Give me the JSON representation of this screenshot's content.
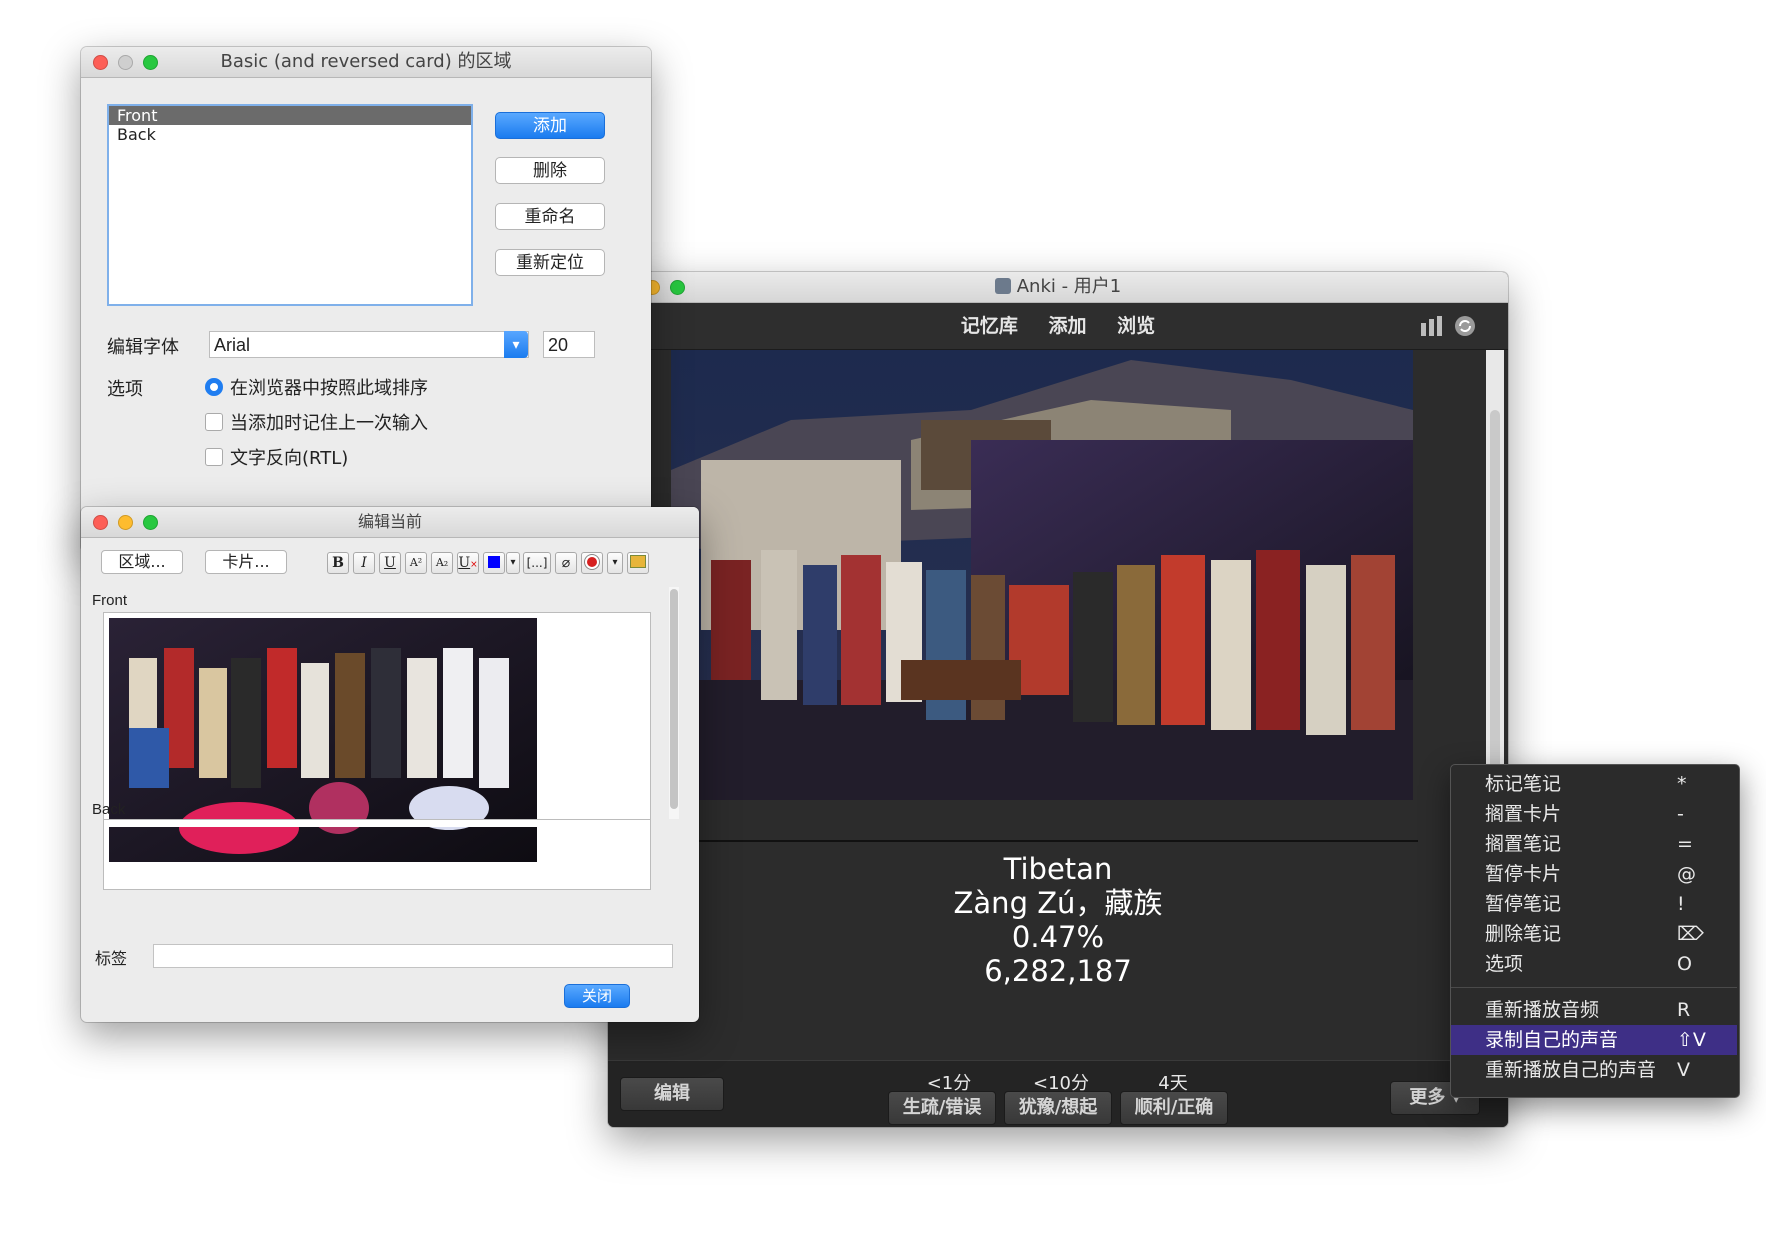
{
  "fields_window": {
    "title": "Basic (and reversed card) 的区域",
    "fields": [
      "Front",
      "Back"
    ],
    "buttons": {
      "add": "添加",
      "delete": "删除",
      "rename": "重命名",
      "reposition": "重新定位"
    },
    "font_label": "编辑字体",
    "font_value": "Arial",
    "font_size": "20",
    "options_label": "选项",
    "options": [
      "在浏览器中按照此域排序",
      "当添加时记住上一次输入",
      "文字反向(RTL)"
    ]
  },
  "edit_window": {
    "title": "编辑当前",
    "fields_button": "区域...",
    "cards_button": "卡片...",
    "toolbar": {
      "bold": "B",
      "italic": "I",
      "underline": "U",
      "superscript": "A²",
      "subscript": "A₂",
      "cloze": "[...]"
    },
    "front_label": "Front",
    "back_label": "Back",
    "tags_label": "标签",
    "close_button": "关闭"
  },
  "anki_window": {
    "title": "Anki - 用户1",
    "nav": {
      "decks": "记忆库",
      "add": "添加",
      "browse": "浏览"
    },
    "answer": {
      "line1": "Tibetan",
      "line2": "Zàng Zú，藏族",
      "line3": "0.47%",
      "line4": "6,282,187"
    },
    "bottom": {
      "edit_button": "编辑",
      "due_again": "<1分",
      "again": "生疏/错误",
      "due_hard": "<10分",
      "hard": "犹豫/想起",
      "due_good": "4天",
      "good": "顺利/正确",
      "more": "更多 ▾"
    }
  },
  "context_menu": {
    "items": [
      {
        "label": "标记笔记",
        "key": "*"
      },
      {
        "label": "搁置卡片",
        "key": "-"
      },
      {
        "label": "搁置笔记",
        "key": "="
      },
      {
        "label": "暂停卡片",
        "key": "@"
      },
      {
        "label": "暂停笔记",
        "key": "!"
      },
      {
        "label": "删除笔记",
        "key": "⌦"
      },
      {
        "label": "选项",
        "key": "O"
      },
      {
        "label": "重新播放音频",
        "key": "R"
      },
      {
        "label": "录制自己的声音",
        "key": "⇧V"
      },
      {
        "label": "重新播放自己的声音",
        "key": "V"
      }
    ],
    "highlighted_index": 8
  },
  "colors": {
    "accent_blue": "#1a7bef",
    "menu_highlight": "#3e2f86",
    "dark_bg": "#2c2c2c"
  }
}
